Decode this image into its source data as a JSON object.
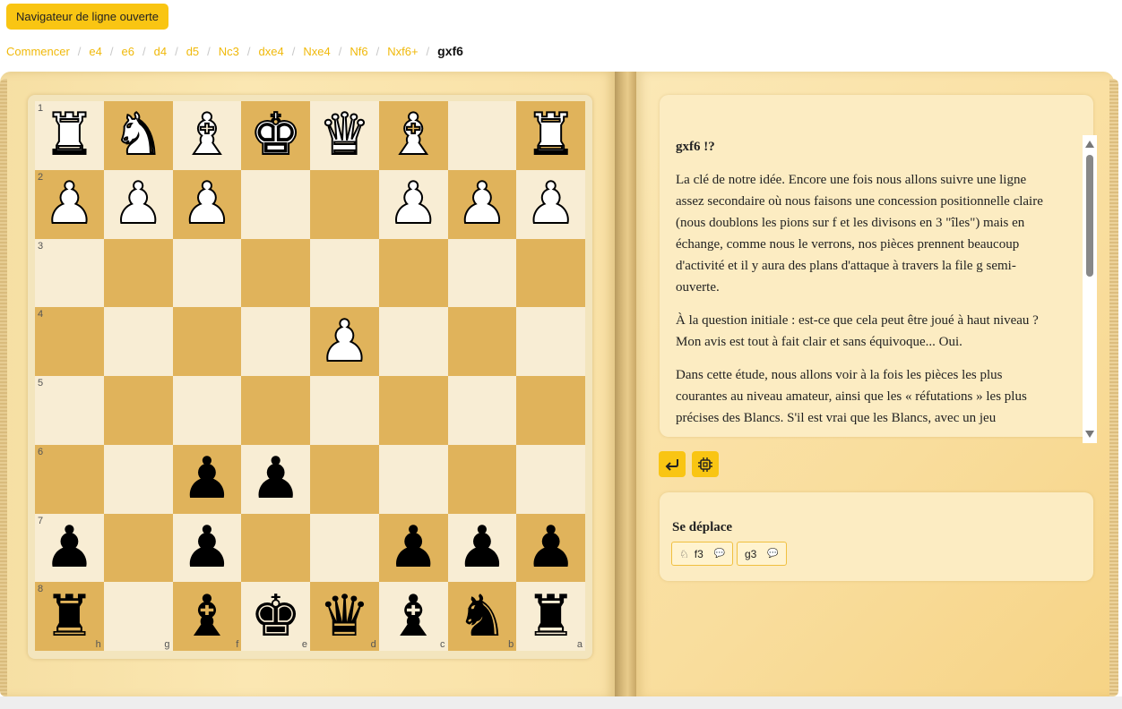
{
  "top_button": {
    "label": "Navigateur de ligne ouverte"
  },
  "breadcrumb": [
    {
      "label": "Commencer"
    },
    {
      "label": "e4"
    },
    {
      "label": "e6"
    },
    {
      "label": "d4"
    },
    {
      "label": "d5"
    },
    {
      "label": "Nc3"
    },
    {
      "label": "dxe4"
    },
    {
      "label": "Nxe4"
    },
    {
      "label": "Nf6"
    },
    {
      "label": "Nxf6+"
    },
    {
      "label": "gxf6",
      "active": true
    }
  ],
  "board": {
    "rank_labels": [
      "1",
      "2",
      "3",
      "4",
      "5",
      "6",
      "7",
      "8"
    ],
    "file_labels": [
      "h",
      "g",
      "f",
      "e",
      "d",
      "c",
      "b",
      "a"
    ],
    "rows": [
      [
        "wR",
        "wN",
        "wB",
        "wK",
        "wQ",
        "wB",
        "",
        "wR"
      ],
      [
        "wP",
        "wP",
        "wP",
        "",
        "",
        "wP",
        "wP",
        "wP"
      ],
      [
        "",
        "",
        "",
        "",
        "",
        "",
        "",
        ""
      ],
      [
        "",
        "",
        "",
        "",
        "wP",
        "",
        "",
        ""
      ],
      [
        "",
        "",
        "",
        "",
        "",
        "",
        "",
        ""
      ],
      [
        "",
        "",
        "bP",
        "bP",
        "",
        "",
        "",
        ""
      ],
      [
        "bP",
        "",
        "bP",
        "",
        "",
        "bP",
        "bP",
        "bP"
      ],
      [
        "bR",
        "",
        "bB",
        "bK",
        "bQ",
        "bB",
        "bN",
        "bR"
      ]
    ]
  },
  "comment": {
    "title": "gxf6 !?",
    "paragraphs": [
      "La clé de notre idée. Encore une fois nous allons suivre une ligne assez secondaire où nous faisons une concession positionnelle claire (nous doublons les pions sur f et les divisons en 3 \"îles\") mais en échange, comme nous le verrons, nos pièces prennent beaucoup d'activité et il y aura des plans d'attaque à travers la file g semi-ouverte.",
      "À la question initiale : est-ce que cela peut être joué à haut niveau ? Mon avis est tout à fait clair et sans équivoque... Oui.",
      "Dans cette étude, nous allons voir à la fois les pièces les plus courantes au niveau amateur, ainsi que les « réfutations » les plus précises des Blancs. S'il est vrai que les Blancs, avec un jeu"
    ]
  },
  "actions": {
    "back_icon": "return-arrow-icon",
    "engine_icon": "chip-icon"
  },
  "moves": {
    "title": "Se déplace",
    "items": [
      {
        "label": "f3",
        "piece_icon": "knight-icon",
        "bubble_icon": "speech-bubble-icon"
      },
      {
        "label": "g3",
        "piece_icon": "",
        "bubble_icon": "speech-bubble-icon"
      }
    ]
  },
  "colors": {
    "accent": "#f9c513",
    "board_light": "#f8edd4",
    "board_dark": "#e0b35b"
  }
}
